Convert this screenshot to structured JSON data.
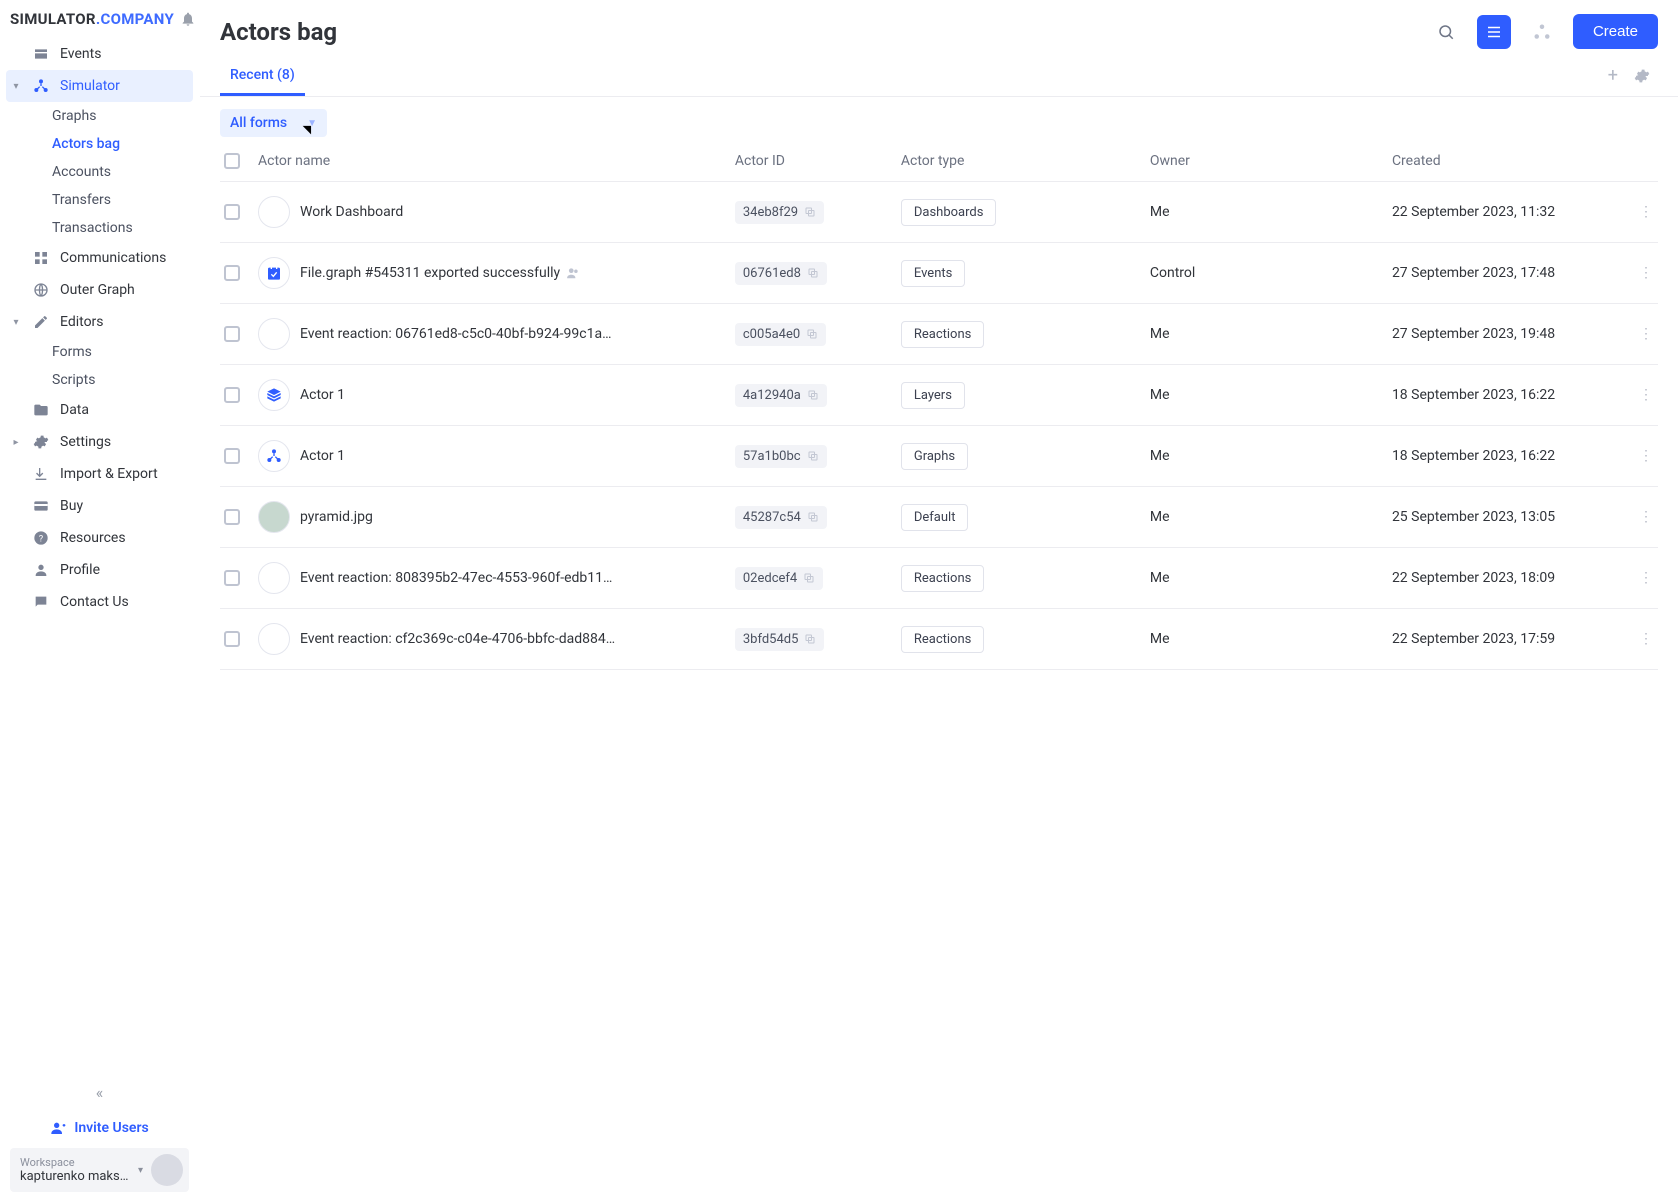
{
  "brand": {
    "part1": "SIMULATOR",
    "part2": ".COMPANY"
  },
  "sidebar": {
    "items": [
      {
        "label": "Events"
      },
      {
        "label": "Simulator"
      },
      {
        "label": "Communications"
      },
      {
        "label": "Outer Graph"
      },
      {
        "label": "Editors"
      },
      {
        "label": "Data"
      },
      {
        "label": "Settings"
      },
      {
        "label": "Import & Export"
      },
      {
        "label": "Buy"
      },
      {
        "label": "Resources"
      },
      {
        "label": "Profile"
      },
      {
        "label": "Contact Us"
      }
    ],
    "simulator_sub": [
      {
        "label": "Graphs"
      },
      {
        "label": "Actors bag"
      },
      {
        "label": "Accounts"
      },
      {
        "label": "Transfers"
      },
      {
        "label": "Transactions"
      }
    ],
    "editors_sub": [
      {
        "label": "Forms"
      },
      {
        "label": "Scripts"
      }
    ],
    "invite": "Invite Users",
    "workspace_label": "Workspace",
    "workspace_name": "kapturenko maksym"
  },
  "page": {
    "title": "Actors bag",
    "create": "Create",
    "tab": "Recent (8)",
    "filter": "All forms"
  },
  "columns": {
    "name": "Actor name",
    "id": "Actor ID",
    "type": "Actor type",
    "owner": "Owner",
    "created": "Created"
  },
  "rows": [
    {
      "icon": "blank",
      "name": "Work Dashboard",
      "name_icon": null,
      "id": "34eb8f29",
      "type": "Dashboards",
      "owner": "Me",
      "created": "22 September 2023, 11:32"
    },
    {
      "icon": "cal",
      "name": "File.graph #545311 exported successfully",
      "name_icon": "users",
      "id": "06761ed8",
      "type": "Events",
      "owner": "Control",
      "created": "27 September 2023, 17:48"
    },
    {
      "icon": "blank",
      "name": "Event reaction: 06761ed8-c5c0-40bf-b924-99c1a…",
      "name_icon": null,
      "id": "c005a4e0",
      "type": "Reactions",
      "owner": "Me",
      "created": "27 September 2023, 19:48"
    },
    {
      "icon": "layer",
      "name": "Actor 1",
      "name_icon": null,
      "id": "4a12940a",
      "type": "Layers",
      "owner": "Me",
      "created": "18 September 2023, 16:22"
    },
    {
      "icon": "node",
      "name": "Actor 1",
      "name_icon": null,
      "id": "57a1b0bc",
      "type": "Graphs",
      "owner": "Me",
      "created": "18 September 2023, 16:22"
    },
    {
      "icon": "img",
      "name": "pyramid.jpg",
      "name_icon": null,
      "id": "45287c54",
      "type": "Default",
      "owner": "Me",
      "created": "25 September 2023, 13:05"
    },
    {
      "icon": "blank",
      "name": "Event reaction: 808395b2-47ec-4553-960f-edb11…",
      "name_icon": null,
      "id": "02edcef4",
      "type": "Reactions",
      "owner": "Me",
      "created": "22 September 2023, 18:09"
    },
    {
      "icon": "blank",
      "name": "Event reaction: cf2c369c-c04e-4706-bbfc-dad884…",
      "name_icon": null,
      "id": "3bfd54d5",
      "type": "Reactions",
      "owner": "Me",
      "created": "22 September 2023, 17:59"
    }
  ]
}
